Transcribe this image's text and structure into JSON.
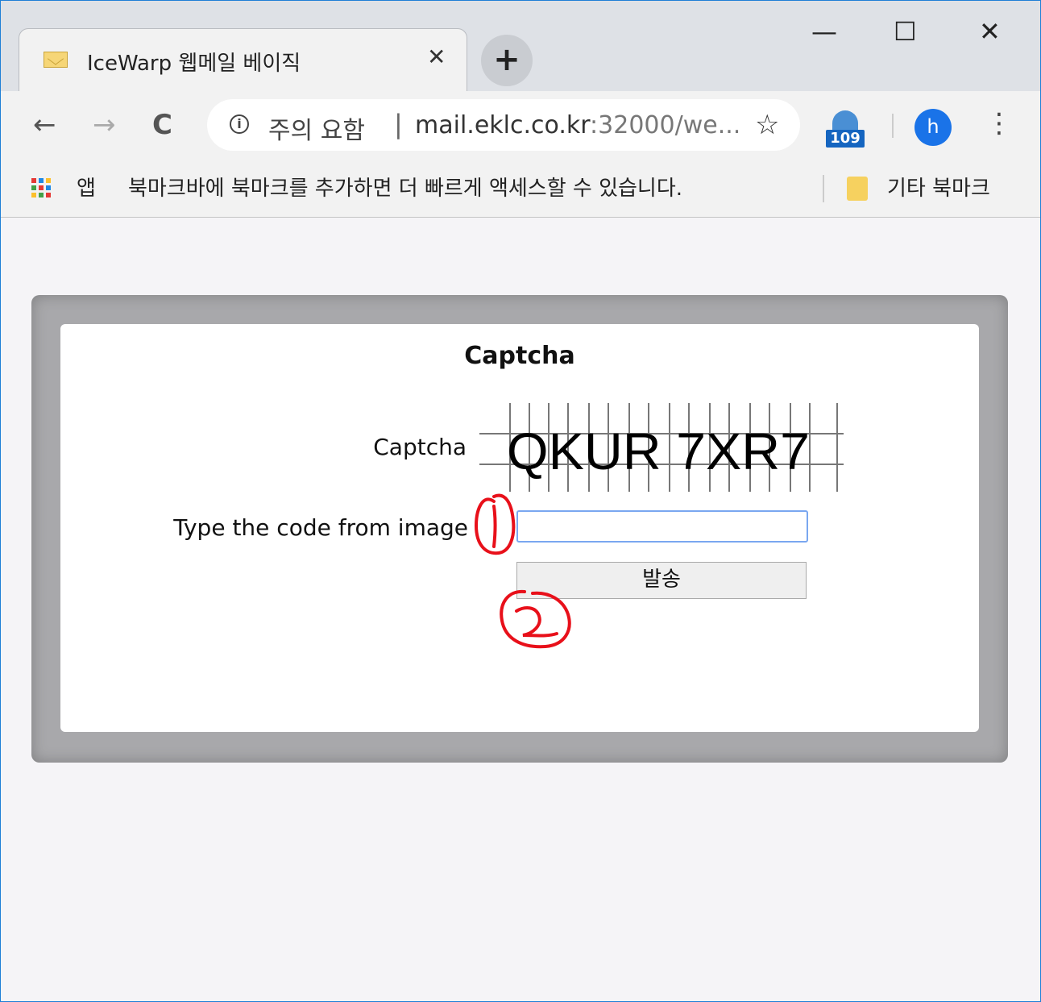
{
  "browser": {
    "tab": {
      "title": "IceWarp 웹메일 베이직",
      "close_glyph": "✕",
      "favicon": "envelope-icon"
    },
    "new_tab_glyph": "+",
    "window_controls": {
      "minimize": "—",
      "maximize": "☐",
      "close": "✕"
    },
    "nav": {
      "back": "←",
      "forward": "→",
      "reload": "C"
    },
    "omnibox": {
      "security_label": "주의 요함",
      "separator": "|",
      "url_host": "mail.eklc.co.kr",
      "url_rest": ":32000/we..."
    },
    "star_glyph": "☆",
    "extension_badge": "109",
    "profile_initial": "h",
    "menu_glyph": "⋮"
  },
  "bookmarks_bar": {
    "apps_label": "앱",
    "hint": "북마크바에 북마크를 추가하면 더 빠르게 액세스할 수 있습니다.",
    "other_bookmarks": "기타 북마크"
  },
  "captcha_form": {
    "title": "Captcha",
    "captcha_label": "Captcha",
    "captcha_code": "QKUR 7XR7",
    "input_label": "Type the code from image",
    "input_value": "",
    "submit_label": "발송"
  },
  "annotations": {
    "mark_1": "①",
    "mark_2": "②"
  },
  "colors": {
    "window_border": "#1f7fd6",
    "frame_gray": "#a8a8ab",
    "annotation_red": "#e8101a",
    "input_focus": "#7aa7f0",
    "avatar": "#1a73e8"
  }
}
